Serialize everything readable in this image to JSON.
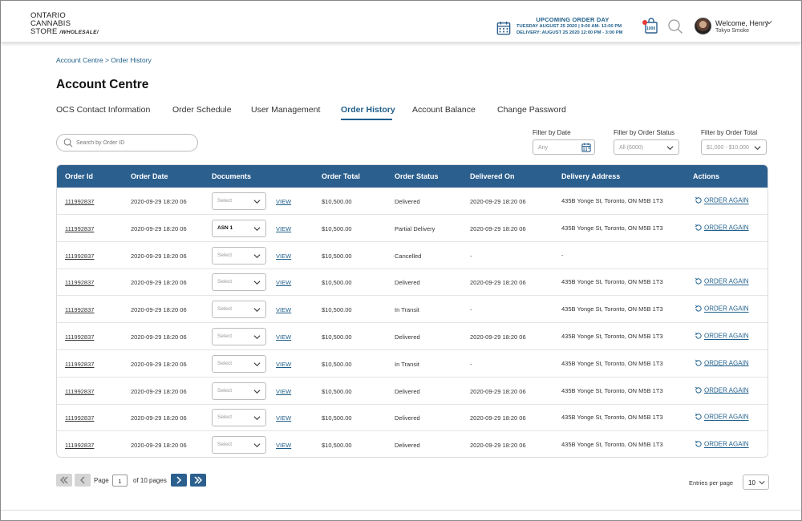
{
  "brand": {
    "line1": "ONTARIO",
    "line2": "CANNABIS",
    "line3": "STORE",
    "line4": "/WHOLESALE/"
  },
  "header": {
    "upcoming_title": "UPCOMING ORDER DAY",
    "upcoming_order": "TUESDAY AUGUST 25 2020 | 9:00 AM- 12:00 PM",
    "upcoming_delivery": "DELIVERY: AUGUST 25 2020 12:00 PM - 3:00 PM",
    "cart_count": "1000",
    "welcome": "Welcome, Henry",
    "company": "Tokyo Smoke"
  },
  "breadcrumb": "Account Centre > Order History",
  "page_title": "Account Centre",
  "tabs": [
    {
      "label": "OCS Contact Information"
    },
    {
      "label": "Order Schedule"
    },
    {
      "label": "User Management"
    },
    {
      "label": "Order History"
    },
    {
      "label": "Account Balance"
    },
    {
      "label": "Change Password"
    }
  ],
  "search": {
    "placeholder": "Search by Order ID"
  },
  "filters": {
    "date_label": "Filter by Date",
    "date_value": "Any",
    "status_label": "Filter by Order Status",
    "status_value": "All (6000)",
    "total_label": "Filter by Order Total",
    "total_value": "$1,000 - $10,000"
  },
  "table": {
    "headers": [
      "Order Id",
      "Order Date",
      "Documents",
      "Order Total",
      "Order Status",
      "Delivered On",
      "Delivery Address",
      "Actions"
    ],
    "view_label": "VIEW",
    "order_again_label": "ORDER AGAIN",
    "rows": [
      {
        "id": "111992837",
        "date": "2020-09-29 18:20 06",
        "doc": "Select",
        "total": "$10,500.00",
        "status": "Delivered",
        "delivered": "2020-09-29 18:20 06",
        "address": "435B Yonge St, Toronto, ON M5B 1T3",
        "action": "ORDER AGAIN"
      },
      {
        "id": "111992837",
        "date": "2020-09-29 18:20 06",
        "doc": "ASN 1",
        "total": "$10,500.00",
        "status": "Partial Delivery",
        "delivered": "2020-09-29 18:20 06",
        "address": "435B Yonge St, Toronto, ON M5B 1T3",
        "action": "ORDER AGAIN"
      },
      {
        "id": "111992837",
        "date": "2020-09-29 18:20 06",
        "doc": "Select",
        "total": "$10,500.00",
        "status": "Cancelled",
        "delivered": "-",
        "address": "-",
        "action": ""
      },
      {
        "id": "111992837",
        "date": "2020-09-29 18:20 06",
        "doc": "Select",
        "total": "$10,500.00",
        "status": "Delivered",
        "delivered": "2020-09-29 18:20 06",
        "address": "435B Yonge St, Toronto, ON M5B 1T3",
        "action": "ORDER AGAIN"
      },
      {
        "id": "111992837",
        "date": "2020-09-29 18:20 06",
        "doc": "Select",
        "total": "$10,500.00",
        "status": "In Transit",
        "delivered": "-",
        "address": "435B Yonge St, Toronto, ON M5B 1T3",
        "action": "ORDER AGAIN"
      },
      {
        "id": "111992837",
        "date": "2020-09-29 18:20 06",
        "doc": "Select",
        "total": "$10,500.00",
        "status": "Delivered",
        "delivered": "2020-09-29 18:20 06",
        "address": "435B Yonge St, Toronto, ON M5B 1T3",
        "action": "ORDER AGAIN"
      },
      {
        "id": "111992837",
        "date": "2020-09-29 18:20 06",
        "doc": "Select",
        "total": "$10,500.00",
        "status": "In Transit",
        "delivered": "-",
        "address": "435B Yonge St, Toronto, ON M5B 1T3",
        "action": "ORDER AGAIN"
      },
      {
        "id": "111992837",
        "date": "2020-09-29 18:20 06",
        "doc": "Select",
        "total": "$10,500.00",
        "status": "Delivered",
        "delivered": "2020-09-29 18:20 06",
        "address": "435B Yonge St, Toronto, ON M5B 1T3",
        "action": "ORDER AGAIN"
      },
      {
        "id": "111992837",
        "date": "2020-09-29 18:20 06",
        "doc": "Select",
        "total": "$10,500.00",
        "status": "Delivered",
        "delivered": "2020-09-29 18:20 06",
        "address": "435B Yonge St, Toronto, ON M5B 1T3",
        "action": "ORDER AGAIN"
      },
      {
        "id": "111992837",
        "date": "2020-09-29 18:20 06",
        "doc": "Select",
        "total": "$10,500.00",
        "status": "Delivered",
        "delivered": "2020-09-29 18:20 06",
        "address": "435B Yonge St, Toronto, ON M5B 1T3",
        "action": "ORDER AGAIN"
      }
    ]
  },
  "pagination": {
    "page_label": "Page",
    "current_page": "1",
    "of_pages": "of 10 pages",
    "entries_label": "Entries per page",
    "entries_value": "10"
  },
  "icons": {
    "calendar": "calendar-icon",
    "cart": "cart-icon",
    "search": "search-icon",
    "refresh": "refresh-icon",
    "chevron": "chevron-down-icon"
  },
  "colors": {
    "primary": "#2b5f8e",
    "link": "#1f5f8b",
    "alert": "#e53935"
  }
}
